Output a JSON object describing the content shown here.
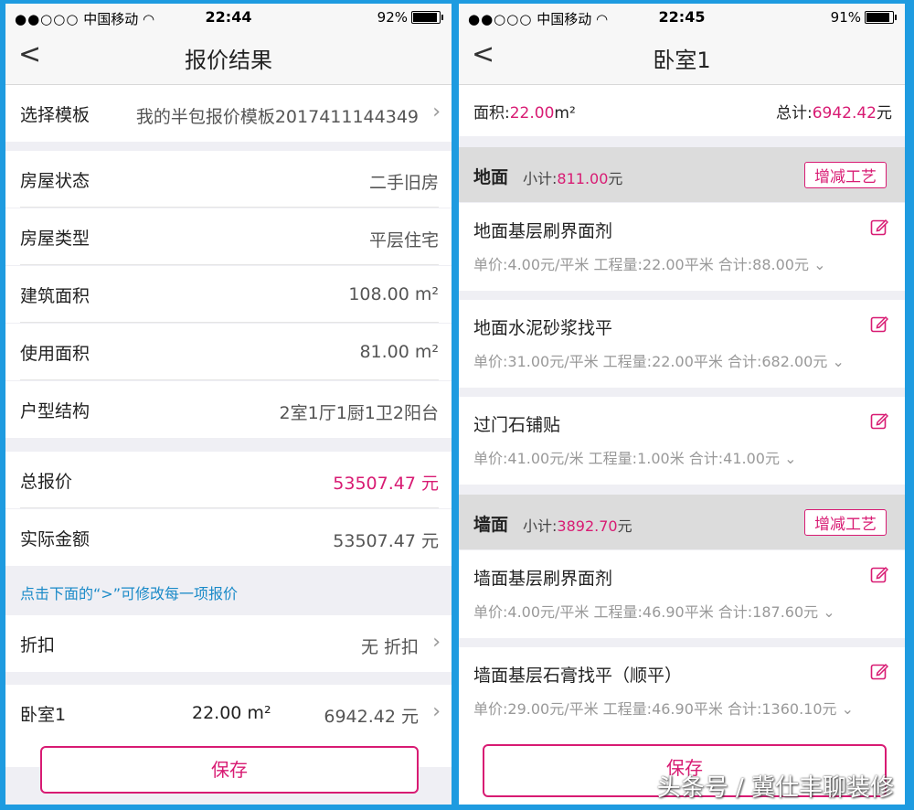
{
  "left": {
    "status": {
      "carrier": "中国移动",
      "time": "22:44",
      "battery": "92%",
      "battery_level": 0.92
    },
    "nav_title": "报价结果",
    "template_row": {
      "label": "选择模板",
      "value": "我的半包报价模板2017411144349"
    },
    "house_rows": [
      {
        "label": "房屋状态",
        "value": "二手旧房"
      },
      {
        "label": "房屋类型",
        "value": "平层住宅"
      },
      {
        "label": "建筑面积",
        "value": "108.00 m²"
      },
      {
        "label": "使用面积",
        "value": "81.00 m²"
      },
      {
        "label": "户型结构",
        "value": "2室1厅1厨1卫2阳台"
      }
    ],
    "total_row": {
      "label": "总报价",
      "value": "53507.47 元"
    },
    "actual_row": {
      "label": "实际金额",
      "value": "53507.47 元"
    },
    "hint": "点击下面的“>”可修改每一项报价",
    "discount_row": {
      "label": "折扣",
      "value": "无 折扣"
    },
    "room_row": {
      "label": "卧室1",
      "area": "22.00 m²",
      "value": "6942.42 元"
    },
    "save_label": "保存"
  },
  "right": {
    "status": {
      "carrier": "中国移动",
      "time": "22:45",
      "battery": "91%",
      "battery_level": 0.91
    },
    "nav_title": "卧室1",
    "area": {
      "label": "面积:",
      "value": "22.00",
      "unit": "m²",
      "total_label": "总计:",
      "total_value": "6942.42",
      "total_unit": "元"
    },
    "sections": [
      {
        "name": "地面",
        "subtotal_label": "小计:",
        "subtotal": "811.00",
        "subtotal_unit": "元",
        "tag": "增减工艺",
        "items": [
          {
            "name": "地面基层刷界面剂",
            "detail": "单价:4.00元/平米 工程量:22.00平米 合计:88.00元"
          },
          {
            "name": "地面水泥砂浆找平",
            "detail": "单价:31.00元/平米 工程量:22.00平米 合计:682.00元"
          },
          {
            "name": "过门石铺贴",
            "detail": "单价:41.00元/米 工程量:1.00米 合计:41.00元"
          }
        ]
      },
      {
        "name": "墙面",
        "subtotal_label": "小计:",
        "subtotal": "3892.70",
        "subtotal_unit": "元",
        "tag": "增减工艺",
        "items": [
          {
            "name": "墙面基层刷界面剂",
            "detail": "单价:4.00元/平米 工程量:46.90平米 合计:187.60元"
          },
          {
            "name": "墙面基层石膏找平（顺平）",
            "detail": "单价:29.00元/平米 工程量:46.90平米 合计:1360.10元"
          }
        ]
      }
    ],
    "save_label": "保存"
  },
  "watermark": "头条号 / 冀仕丰聊装修",
  "colors": {
    "accent": "#d81b73",
    "link": "#1a8ac8",
    "frame": "#1e9be0"
  }
}
